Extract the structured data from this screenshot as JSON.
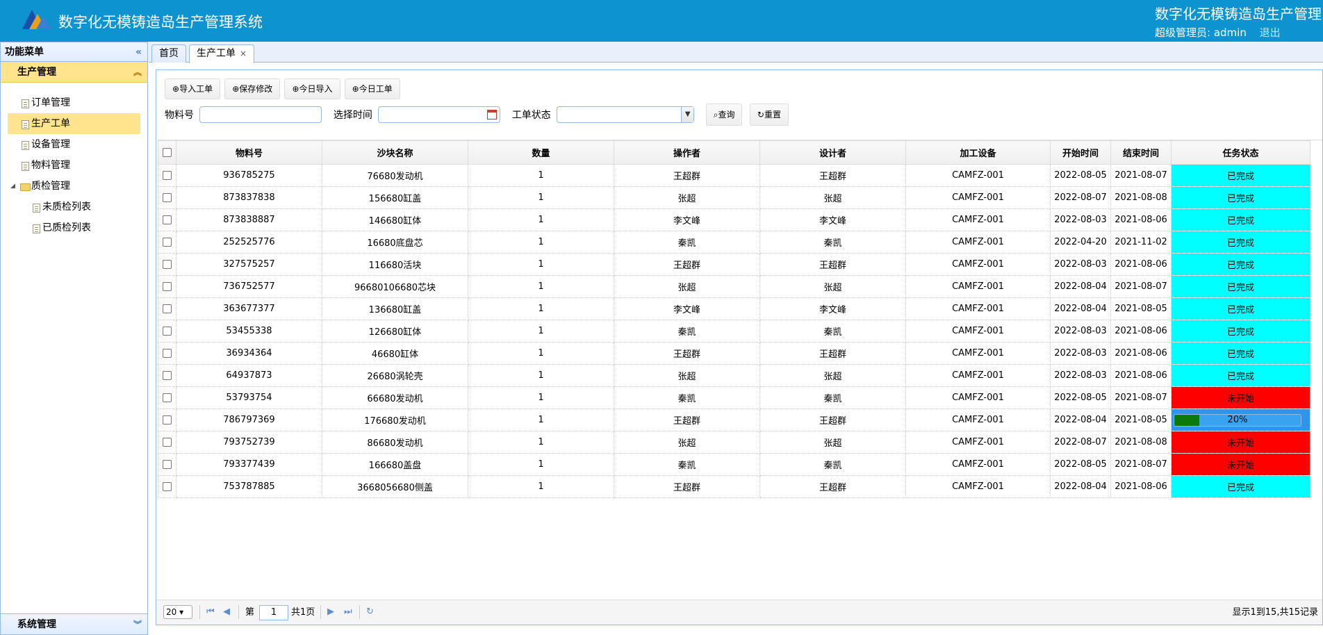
{
  "header": {
    "title": "数字化无模铸造岛生产管理系统",
    "title_right": "数字化无模铸造岛生产管理系统",
    "user_label": "超级管理员: admin",
    "logout": "退出"
  },
  "sidebar": {
    "title": "功能菜单",
    "collapse_icon": "«",
    "group": "生产管理",
    "group_icon": "chevron-double-up-icon",
    "items": [
      {
        "label": "订单管理"
      },
      {
        "label": "生产工单",
        "selected": true
      },
      {
        "label": "设备管理"
      },
      {
        "label": "物料管理"
      },
      {
        "label": "质检管理",
        "folder": true
      },
      {
        "label": "未质检列表",
        "child": true
      },
      {
        "label": "已质检列表",
        "child": true
      }
    ],
    "bottom_group": "系统管理"
  },
  "tabs": [
    {
      "label": "首页"
    },
    {
      "label": "生产工单",
      "active": true,
      "close": "×"
    }
  ],
  "toolbar": {
    "import": "导入工单",
    "save": "保存修改",
    "today_import": "今日导入",
    "today_order": "今日工单"
  },
  "search": {
    "material_label": "物料号",
    "material_value": "",
    "time_label": "选择时间",
    "time_value": "",
    "status_label": "工单状态",
    "status_value": "",
    "query": "查询",
    "reset": "重置"
  },
  "table": {
    "columns": [
      "物料号",
      "沙块名称",
      "数量",
      "操作者",
      "设计者",
      "加工设备",
      "开始时间",
      "结束时间",
      "任务状态"
    ],
    "rows": [
      [
        "936785275",
        "76680发动机",
        "1",
        "王超群",
        "王超群",
        "CAMFZ-001",
        "2022-08-05",
        "2021-08-07",
        "已完成"
      ],
      [
        "873837838",
        "156680缸盖",
        "1",
        "张超",
        "张超",
        "CAMFZ-001",
        "2022-08-07",
        "2021-08-08",
        "已完成"
      ],
      [
        "873838887",
        "146680缸体",
        "1",
        "李文峰",
        "李文峰",
        "CAMFZ-001",
        "2022-08-03",
        "2021-08-06",
        "已完成"
      ],
      [
        "252525776",
        "16680底盘芯",
        "1",
        "秦凯",
        "秦凯",
        "CAMFZ-001",
        "2022-04-20",
        "2021-11-02",
        "已完成"
      ],
      [
        "327575257",
        "116680活块",
        "1",
        "王超群",
        "王超群",
        "CAMFZ-001",
        "2022-08-03",
        "2021-08-06",
        "已完成"
      ],
      [
        "736752577",
        "96680106680芯块",
        "1",
        "张超",
        "张超",
        "CAMFZ-001",
        "2022-08-04",
        "2021-08-07",
        "已完成"
      ],
      [
        "363677377",
        "136680缸盖",
        "1",
        "李文峰",
        "李文峰",
        "CAMFZ-001",
        "2022-08-04",
        "2021-08-05",
        "已完成"
      ],
      [
        "53455338",
        "126680缸体",
        "1",
        "秦凯",
        "秦凯",
        "CAMFZ-001",
        "2022-08-03",
        "2021-08-06",
        "已完成"
      ],
      [
        "36934364",
        "46680缸体",
        "1",
        "王超群",
        "王超群",
        "CAMFZ-001",
        "2022-08-03",
        "2021-08-06",
        "已完成"
      ],
      [
        "64937873",
        "26680涡轮壳",
        "1",
        "张超",
        "张超",
        "CAMFZ-001",
        "2022-08-03",
        "2021-08-06",
        "已完成"
      ],
      [
        "53793754",
        "66680发动机",
        "1",
        "秦凯",
        "秦凯",
        "CAMFZ-001",
        "2022-08-05",
        "2021-08-07",
        "未开始"
      ],
      [
        "786797369",
        "176680发动机",
        "1",
        "王超群",
        "王超群",
        "CAMFZ-001",
        "2022-08-04",
        "2021-08-05",
        "20%"
      ],
      [
        "793752739",
        "86680发动机",
        "1",
        "张超",
        "张超",
        "CAMFZ-001",
        "2022-08-07",
        "2021-08-08",
        "未开始"
      ],
      [
        "793377439",
        "166680盖盘",
        "1",
        "秦凯",
        "秦凯",
        "CAMFZ-001",
        "2022-08-05",
        "2021-08-07",
        "未开始"
      ],
      [
        "753787885",
        "3668056680侧盖",
        "1",
        "王超群",
        "王超群",
        "CAMFZ-001",
        "2022-08-04",
        "2021-08-06",
        "已完成"
      ]
    ],
    "progress_fraction": 0.2
  },
  "pager": {
    "page_size": "20",
    "page_prefix": "第",
    "page_value": "1",
    "page_total": "共1页",
    "info": "显示1到15,共15记录"
  },
  "colors": {
    "header": "#0d94d0",
    "done": "#00ffff",
    "todo": "#ff0000",
    "progress_bg": "#2d96ea",
    "progress_fill": "#0b7a0b"
  }
}
